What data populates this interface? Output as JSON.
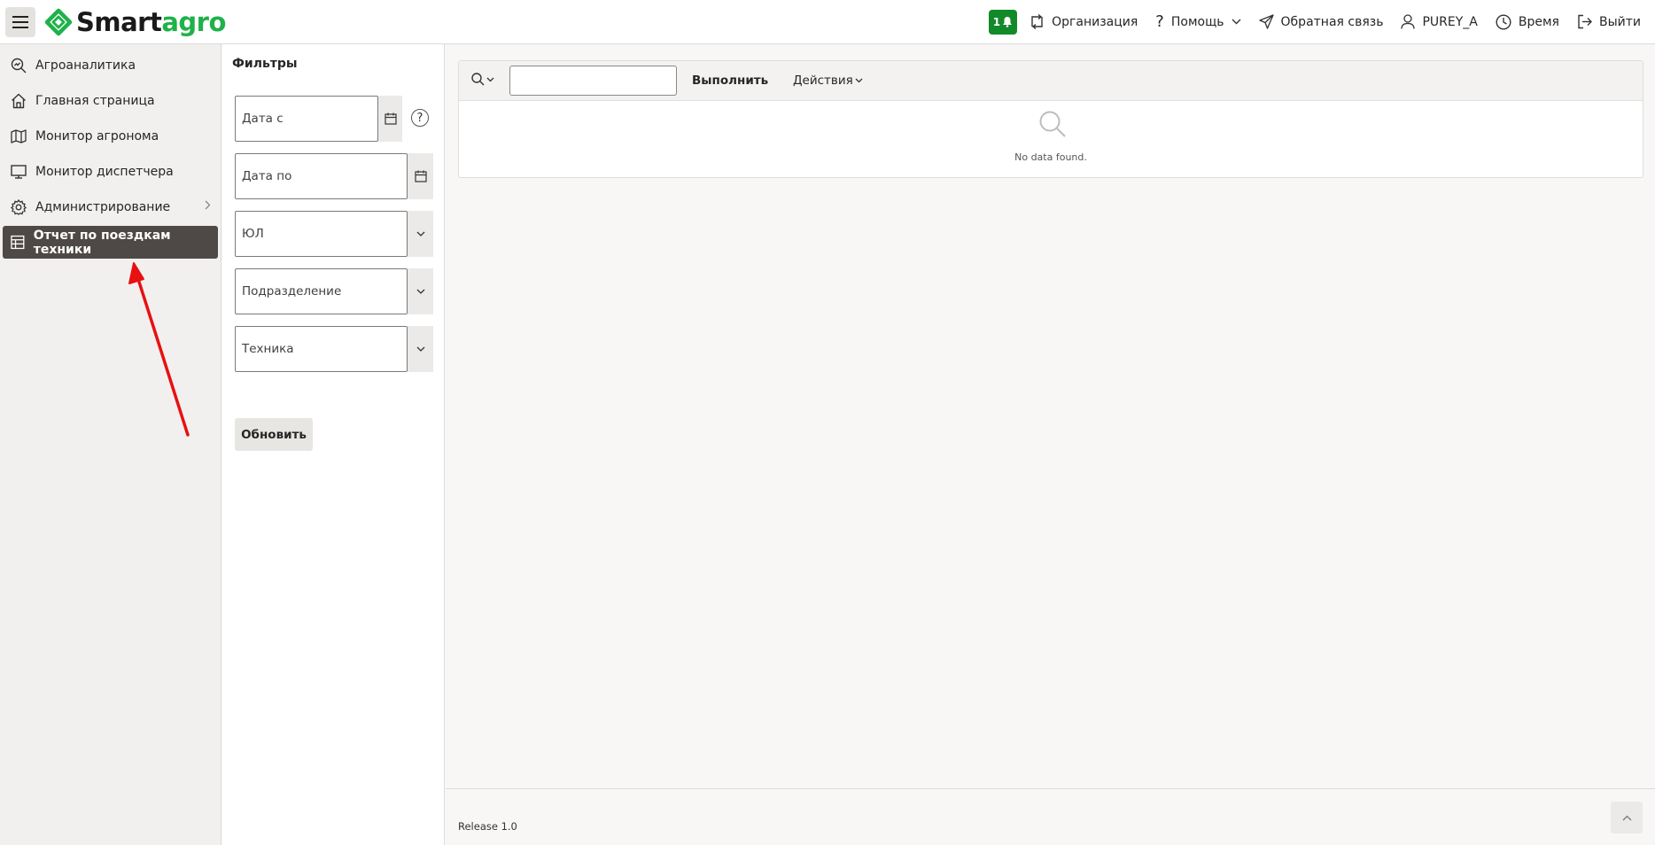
{
  "header": {
    "logo_smart": "Smart",
    "logo_agro": "agro",
    "notification_count": "1",
    "nav": {
      "organization": "Организация",
      "help": "Помощь",
      "feedback": "Обратная связь",
      "user": "PUREY_A",
      "time": "Время",
      "logout": "Выйти"
    }
  },
  "sidebar": {
    "items": [
      {
        "label": "Агроаналитика",
        "icon": "search-chart-icon"
      },
      {
        "label": "Главная страница",
        "icon": "home-icon"
      },
      {
        "label": "Монитор агронома",
        "icon": "map-icon"
      },
      {
        "label": "Монитор диспетчера",
        "icon": "monitor-icon"
      },
      {
        "label": "Администрирование",
        "icon": "gear-icon"
      },
      {
        "label": "Отчет по поездкам техники",
        "icon": "table-icon",
        "active": true
      }
    ]
  },
  "filters": {
    "title": "Фильтры",
    "date_from": "Дата с",
    "date_to": "Дата по",
    "legal_entity": "ЮЛ",
    "division": "Подразделение",
    "machinery": "Техника",
    "refresh_label": "Обновить"
  },
  "report": {
    "search_value": "",
    "go_label": "Выполнить",
    "actions_label": "Действия",
    "no_data": "No data found."
  },
  "footer": {
    "release": "Release 1.0"
  },
  "colors": {
    "brand_green": "#1fb14a",
    "badge_green": "#138a2a",
    "active_nav": "#4e4946",
    "annotation_red": "#e81010"
  }
}
